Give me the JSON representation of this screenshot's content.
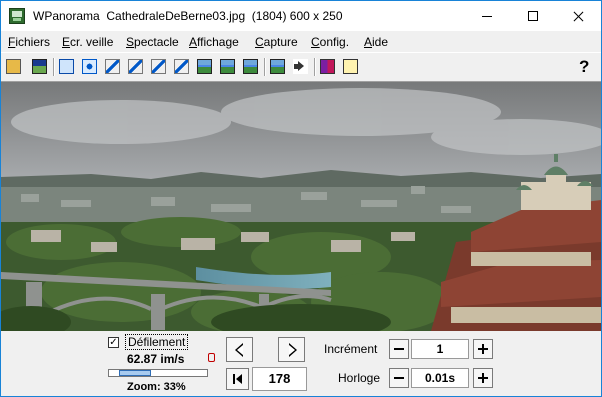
{
  "window": {
    "title": "WPanorama  CathedraleDeBerne03.jpg  (1804) 600 x 250"
  },
  "menu": [
    {
      "first": "F",
      "rest": "ichiers"
    },
    {
      "first": "E",
      "rest": "cr. veille"
    },
    {
      "first": "S",
      "rest": "pectacle"
    },
    {
      "first": "A",
      "rest": "ffichage"
    },
    {
      "first": "C",
      "rest": "apture"
    },
    {
      "first": "C",
      "rest": "onfig."
    },
    {
      "first": "A",
      "rest": "ide"
    }
  ],
  "toolbar": {
    "icons": [
      "open-file-icon",
      "picture-icon",
      "fit-window-icon",
      "move-arrows-icon",
      "shrink-diagonal-icon",
      "expand-diagonal-icon",
      "shrink-corner-icon",
      "expand-corner-icon",
      "film-icon",
      "landscape-icon",
      "horizon-icon",
      "mountain-icon",
      "volume-icon",
      "book-icon",
      "help-file-icon"
    ],
    "help_label": "?"
  },
  "colors": {
    "window_border": "#1883d7",
    "slider_fill": "#a8cbef",
    "indicator": "#c00000"
  },
  "controls": {
    "scroll_checkbox_mark": "✓",
    "scroll_label": "Défilement",
    "speed": "62.87 im/s",
    "zoom": "Zoom: 33%",
    "slider_level_percent": 33,
    "frame_value": "178",
    "increment_label": "Incrément",
    "increment_value": "1",
    "clock_label": "Horloge",
    "clock_value": "0.01s"
  }
}
